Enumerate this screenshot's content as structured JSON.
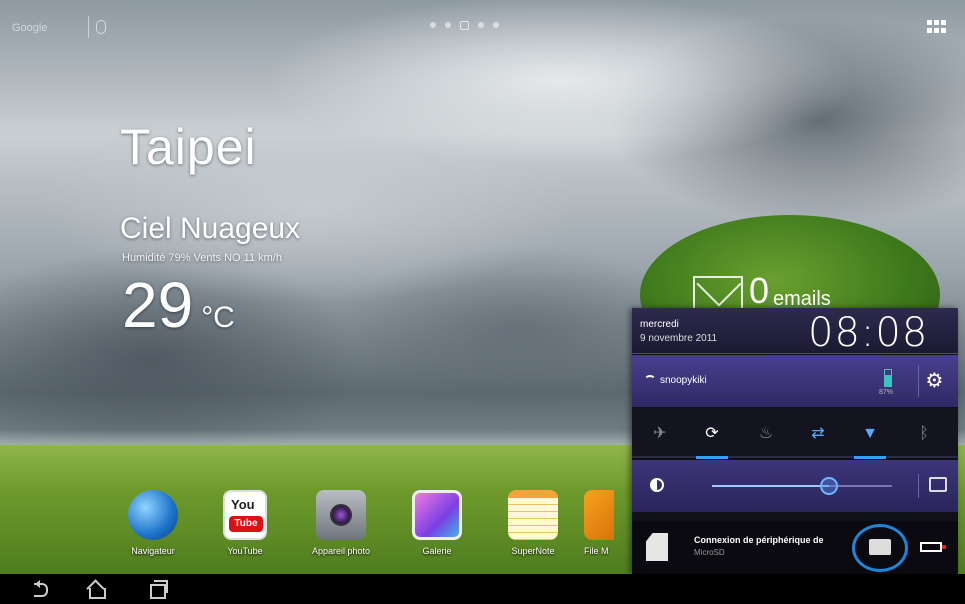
{
  "status_bar": {
    "search_label": "Google",
    "page_dots": 5,
    "current_page": 3
  },
  "weather": {
    "city": "Taipei",
    "condition": "Ciel Nuageux",
    "wind": "Humidité 79% Vents NO 11 km/h",
    "temperature": "29",
    "unit": "°C"
  },
  "email_widget": {
    "count": "0",
    "label": "emails"
  },
  "dock": {
    "apps": [
      {
        "label": "Navigateur",
        "icon": "globe-icon"
      },
      {
        "label": "YouTube",
        "icon": "youtube-icon"
      },
      {
        "label": "Appareil photo",
        "icon": "camera-icon"
      },
      {
        "label": "Galerie",
        "icon": "gallery-icon"
      },
      {
        "label": "SuperNote",
        "icon": "notepad-icon"
      },
      {
        "label": "File M",
        "icon": "folder-icon"
      }
    ],
    "youtube_you": "You",
    "youtube_tube": "Tube"
  },
  "panel": {
    "day": "mercredi",
    "date": "9 novembre 2011",
    "time": "08:08",
    "wifi_name": "snoopykiki",
    "battery_text": "87%",
    "toggles": [
      {
        "name": "airplane-mode",
        "glyph": "✈",
        "on": false
      },
      {
        "name": "auto-rotate",
        "glyph": "⟳",
        "on": true
      },
      {
        "name": "power-saving",
        "glyph": "♨",
        "on": false
      },
      {
        "name": "sync",
        "glyph": "⇄",
        "on": false
      },
      {
        "name": "wifi",
        "glyph": "▼",
        "on": true
      },
      {
        "name": "bluetooth",
        "glyph": "ᛒ",
        "on": false
      }
    ],
    "brightness": 0.65,
    "usb_title": "Connexion de périphérique de",
    "usb_subtitle": "MicroSD"
  },
  "colors": {
    "panel_accent": "#33a0ff",
    "panel_header": "#2e2a4e",
    "wifi_row": "#4a3f8f",
    "highlight_circle": "#1e86d8"
  }
}
